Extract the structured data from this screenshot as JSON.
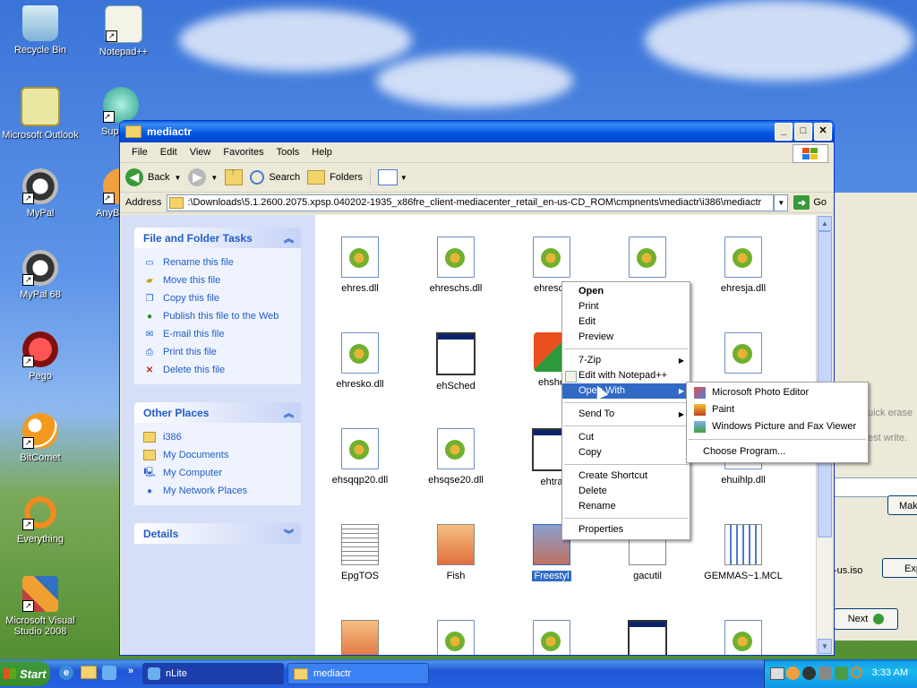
{
  "desktop": {
    "icons": [
      {
        "label": "Recycle Bin"
      },
      {
        "label": "Notepad++"
      },
      {
        "label": "Microsoft Outlook"
      },
      {
        "label": "Supe"
      },
      {
        "label": "MyPal"
      },
      {
        "label": "AnyB"
      },
      {
        "label": "MyPal 68"
      },
      {
        "label": "Pego"
      },
      {
        "label": "BitComet"
      },
      {
        "label": "Everything"
      },
      {
        "label": "Microsoft Visual Studio 2008"
      }
    ]
  },
  "window": {
    "title": "mediactr",
    "menu": [
      "File",
      "Edit",
      "View",
      "Favorites",
      "Tools",
      "Help"
    ],
    "toolbar": {
      "back": "Back",
      "search": "Search",
      "folders": "Folders"
    },
    "address": {
      "label": "Address",
      "value": ":\\Downloads\\5.1.2600.2075.xpsp.040202-1935_x86fre_client-mediacenter_retail_en-us-CD_ROM\\cmpnents\\mediactr\\i386\\mediactr",
      "go": "Go"
    }
  },
  "tasks": {
    "file_folder": {
      "title": "File and Folder Tasks",
      "items": [
        "Rename this file",
        "Move this file",
        "Copy this file",
        "Publish this file to the Web",
        "E-mail this file",
        "Print this file",
        "Delete this file"
      ]
    },
    "other_places": {
      "title": "Other Places",
      "items": [
        "i386",
        "My Documents",
        "My Computer",
        "My Network Places"
      ]
    },
    "details": {
      "title": "Details"
    }
  },
  "files": [
    {
      "name": "ehres.dll",
      "type": "dll"
    },
    {
      "name": "ehreschs.dll",
      "type": "dll"
    },
    {
      "name": "ehresde",
      "type": "dll"
    },
    {
      "name": "",
      "type": "dll"
    },
    {
      "name": "ehresja.dll",
      "type": "dll"
    },
    {
      "name": "ehresko.dll",
      "type": "dll"
    },
    {
      "name": "ehSched",
      "type": "window"
    },
    {
      "name": "ehshe",
      "type": "xp"
    },
    {
      "name": "",
      "type": "blank"
    },
    {
      "name": "",
      "type": "dll"
    },
    {
      "name": "ehsqqp20.dll",
      "type": "dll"
    },
    {
      "name": "ehsqse20.dll",
      "type": "dll"
    },
    {
      "name": "ehtra",
      "type": "window"
    },
    {
      "name": "",
      "type": "blank"
    },
    {
      "name": "ehuihlp.dll",
      "type": "dll"
    },
    {
      "name": "EpgTOS",
      "type": "text"
    },
    {
      "name": "Fish",
      "type": "image"
    },
    {
      "name": "Freestyl",
      "type": "image",
      "selected": true
    },
    {
      "name": "gacutil",
      "type": "window"
    },
    {
      "name": "GEMMAS~1.MCL",
      "type": "grid"
    }
  ],
  "context_menu": {
    "items": [
      "Open",
      "Print",
      "Edit",
      "Preview",
      "7-Zip",
      "Edit with Notepad++",
      "Open With",
      "Send To",
      "Cut",
      "Copy",
      "Create Shortcut",
      "Delete",
      "Rename",
      "Properties"
    ]
  },
  "open_with": {
    "items": [
      "Microsoft Photo Editor",
      "Paint",
      "Windows Picture and Fax Viewer",
      "Choose Program..."
    ]
  },
  "background_dialog": {
    "text1": "uick erase",
    "text2": "est write.",
    "btn_mak": "Mak",
    "iso": "-us.iso",
    "btn_exp": "Exp",
    "next": "Next"
  },
  "taskbar": {
    "start": "Start",
    "tasks": [
      "nLite",
      "mediactr"
    ],
    "clock": "3:33 AM"
  }
}
